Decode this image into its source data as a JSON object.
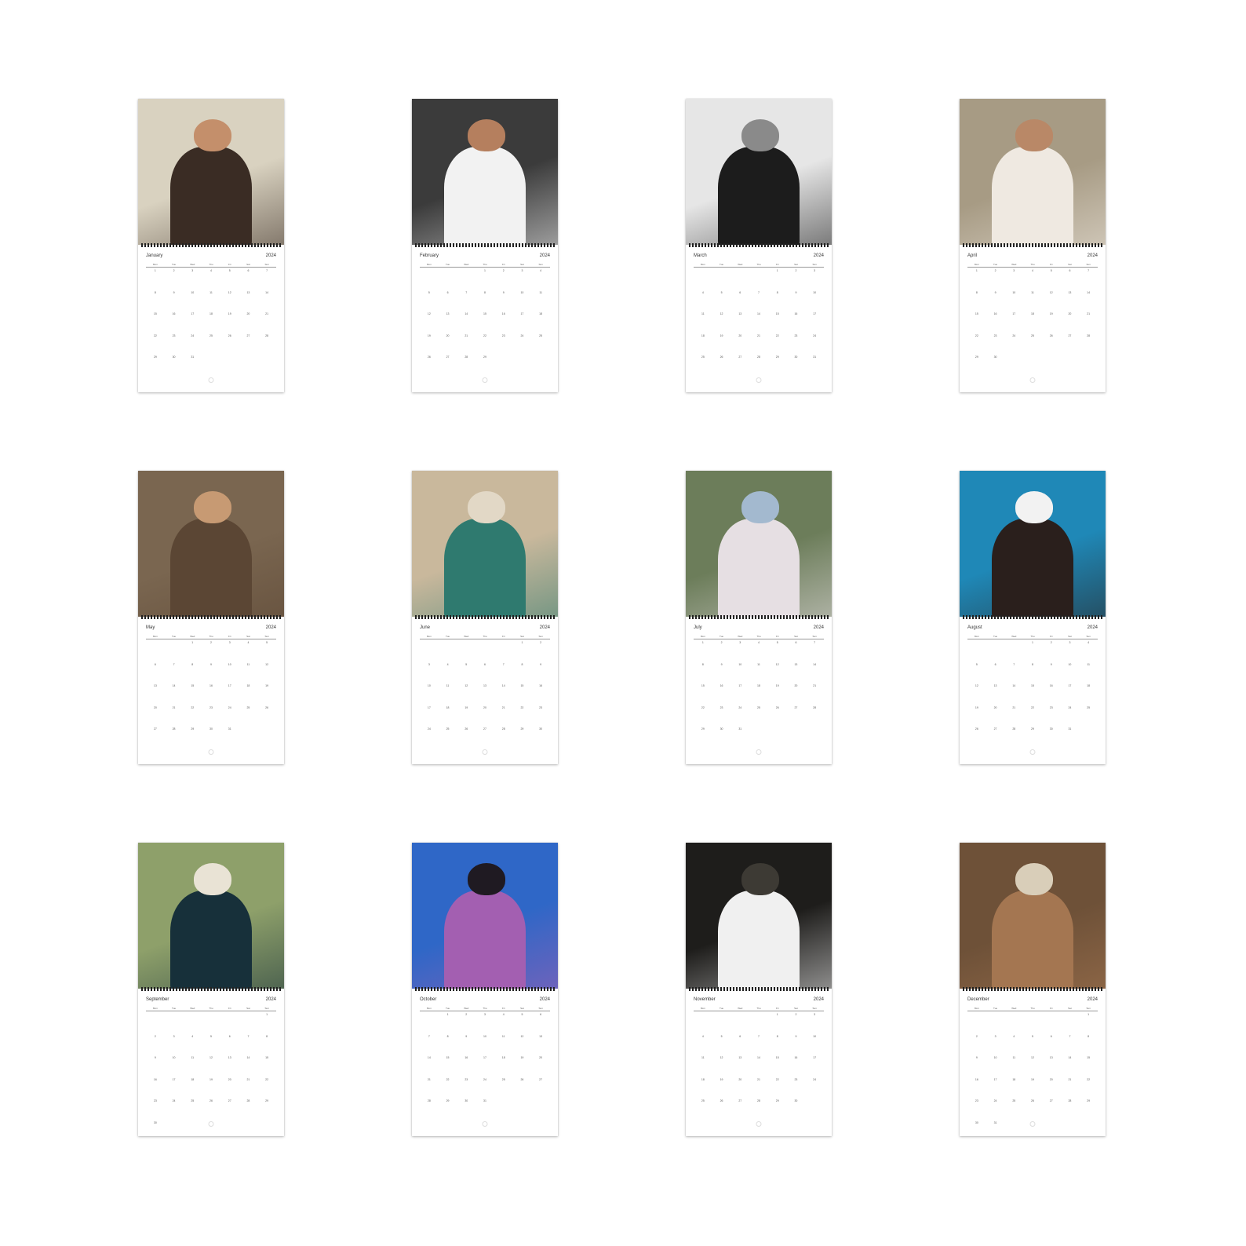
{
  "year": "2024",
  "weekdays": [
    "Mon",
    "Tue",
    "Wed",
    "Thu",
    "Fri",
    "Sat",
    "Sun"
  ],
  "months": [
    {
      "name": "January",
      "start": 0,
      "days": 31,
      "palette": [
        "#d9d2c0",
        "#3a2c24",
        "#c48f6b"
      ]
    },
    {
      "name": "February",
      "start": 3,
      "days": 29,
      "palette": [
        "#3b3b3b",
        "#f2f2f2",
        "#b57f5e"
      ]
    },
    {
      "name": "March",
      "start": 4,
      "days": 31,
      "palette": [
        "#e6e6e6",
        "#1c1c1c",
        "#8a8a8a"
      ]
    },
    {
      "name": "April",
      "start": 0,
      "days": 30,
      "palette": [
        "#a79b84",
        "#efe9e1",
        "#b98867"
      ]
    },
    {
      "name": "May",
      "start": 2,
      "days": 31,
      "palette": [
        "#7a6650",
        "#5b4634",
        "#c79a73"
      ]
    },
    {
      "name": "June",
      "start": 5,
      "days": 30,
      "palette": [
        "#c9b89c",
        "#2f7a6f",
        "#e2d8c6"
      ]
    },
    {
      "name": "July",
      "start": 0,
      "days": 31,
      "palette": [
        "#6c7d5a",
        "#e6dfe3",
        "#a3b9cf"
      ]
    },
    {
      "name": "August",
      "start": 3,
      "days": 31,
      "palette": [
        "#1f88b7",
        "#2a1f1c",
        "#f2f2f2"
      ]
    },
    {
      "name": "September",
      "start": 6,
      "days": 30,
      "palette": [
        "#8ea06a",
        "#17303a",
        "#e9e3d5"
      ]
    },
    {
      "name": "October",
      "start": 1,
      "days": 31,
      "palette": [
        "#2f67c7",
        "#a35fb1",
        "#1f1a22"
      ]
    },
    {
      "name": "November",
      "start": 4,
      "days": 30,
      "palette": [
        "#1e1d1b",
        "#f0f0f0",
        "#3d3a34"
      ]
    },
    {
      "name": "December",
      "start": 6,
      "days": 31,
      "palette": [
        "#6e5138",
        "#a47651",
        "#d9ceb9"
      ]
    }
  ]
}
